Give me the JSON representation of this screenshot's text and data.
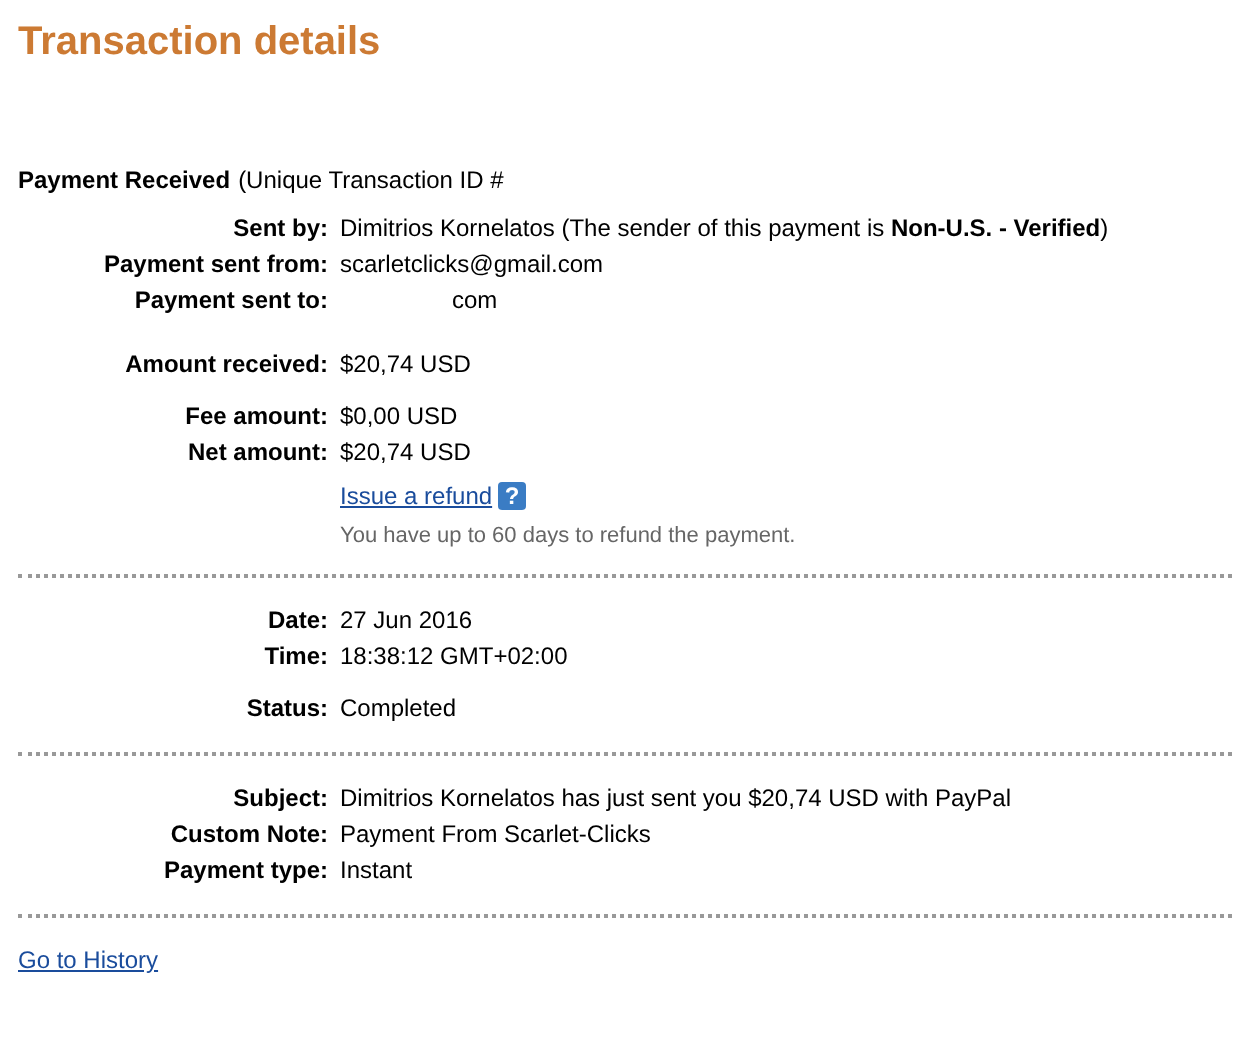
{
  "title": "Transaction details",
  "header": {
    "label": "Payment Received",
    "text": "(Unique Transaction ID #"
  },
  "sections": [
    {
      "groups": [
        [
          {
            "label": "Sent by:",
            "value": "Dimitrios Kornelatos (The sender of this payment is **Non-U.S. - Verified**)"
          },
          {
            "label": "Payment sent from:",
            "value": "scarletclicks@gmail.com"
          },
          {
            "label": "Payment sent to:",
            "value": "com",
            "indent": true
          }
        ],
        [
          {
            "label": "Amount received:",
            "value": "$20,74 USD"
          }
        ],
        [
          {
            "label": "Fee amount:",
            "value": "$0,00 USD"
          },
          {
            "label": "Net amount:",
            "value": "$20,74 USD"
          }
        ]
      ],
      "refund": {
        "link": "Issue a refund",
        "help": "?",
        "note": "You have up to 60 days to refund the payment."
      }
    },
    {
      "groups": [
        [
          {
            "label": "Date:",
            "value": "27 Jun 2016"
          },
          {
            "label": "Time:",
            "value": "18:38:12 GMT+02:00"
          }
        ],
        [
          {
            "label": "Status:",
            "value": "Completed"
          }
        ]
      ]
    },
    {
      "groups": [
        [
          {
            "label": "Subject:",
            "value": "Dimitrios Kornelatos has just sent you $20,74 USD with PayPal"
          },
          {
            "label": "Custom Note:",
            "value": "Payment From Scarlet-Clicks"
          },
          {
            "label": "Payment type:",
            "value": "Instant"
          }
        ]
      ]
    }
  ],
  "footer_link": "Go to History"
}
